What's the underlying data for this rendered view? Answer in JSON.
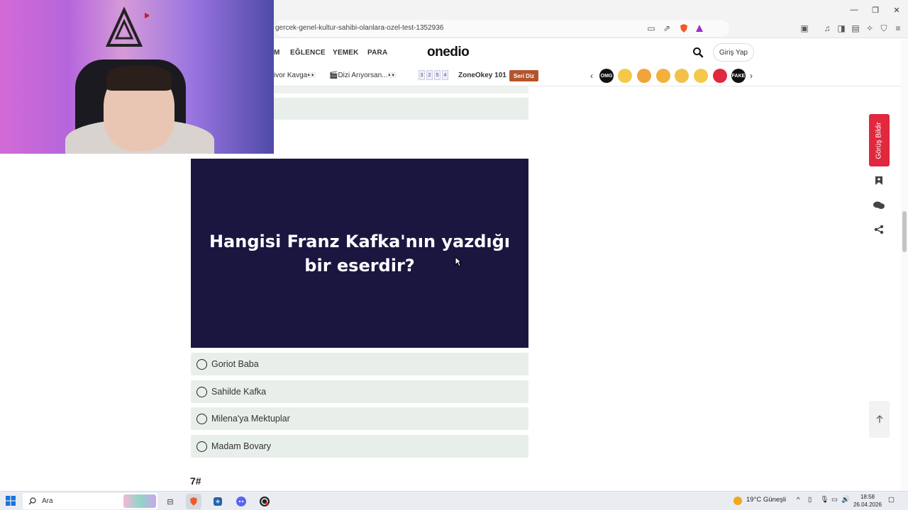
{
  "browser": {
    "url": "gercek-genel-kultur-sahibi-olanlara-ozel-test-1352936",
    "window_controls": {
      "minimize": "—",
      "restore": "❐",
      "close": "✕"
    }
  },
  "site": {
    "logo": "onedio",
    "nav": [
      {
        "label": "M"
      },
      {
        "label": "EĞLENCE"
      },
      {
        "label": "YEMEK"
      },
      {
        "label": "PARA"
      }
    ],
    "login_label": "Giriş Yap",
    "strip": {
      "item1": "ivor Kavga👀",
      "item2": "🎬Dizi Arıyorsan...👀",
      "digits": [
        "3",
        "2",
        "5",
        "4"
      ],
      "zone_label": "ZoneOkey 101",
      "zone_badge": "Seri Diz"
    },
    "emoji_row": [
      {
        "name": "omg-emoji",
        "label": "OMG",
        "color": "#111111"
      },
      {
        "name": "nerd-emoji",
        "label": "",
        "color": "#f5c84a"
      },
      {
        "name": "puzzle-emoji",
        "label": "",
        "color": "#f0a43a"
      },
      {
        "name": "heart-eyes-emoji",
        "label": "",
        "color": "#f2b13b"
      },
      {
        "name": "crying-emoji",
        "label": "",
        "color": "#f3c14a"
      },
      {
        "name": "smile-emoji",
        "label": "",
        "color": "#f5c84a"
      },
      {
        "name": "turkey-flag-emoji",
        "label": "",
        "color": "#e0283e"
      },
      {
        "name": "fake-emoji",
        "label": "FAKE",
        "color": "#111111"
      }
    ]
  },
  "quiz": {
    "question": "Hangisi Franz Kafka'nın yazdığı bir eserdir?",
    "options": [
      {
        "label": "Goriot Baba"
      },
      {
        "label": "Sahilde Kafka"
      },
      {
        "label": "Milena'ya Mektuplar"
      },
      {
        "label": "Madam Bovary"
      }
    ],
    "next_number": "7#"
  },
  "side_tools": {
    "feedback_label": "Görüş Bildir"
  },
  "taskbar": {
    "search_label": "Ara",
    "weather": "19°C Güneşli",
    "time": "18:58",
    "date": "26.04.2026"
  },
  "colors": {
    "question_bg": "#1b1640",
    "option_bg": "#e8efea",
    "feedback_bg": "#e0283e",
    "zone_badge_bg": "#b3542b"
  }
}
